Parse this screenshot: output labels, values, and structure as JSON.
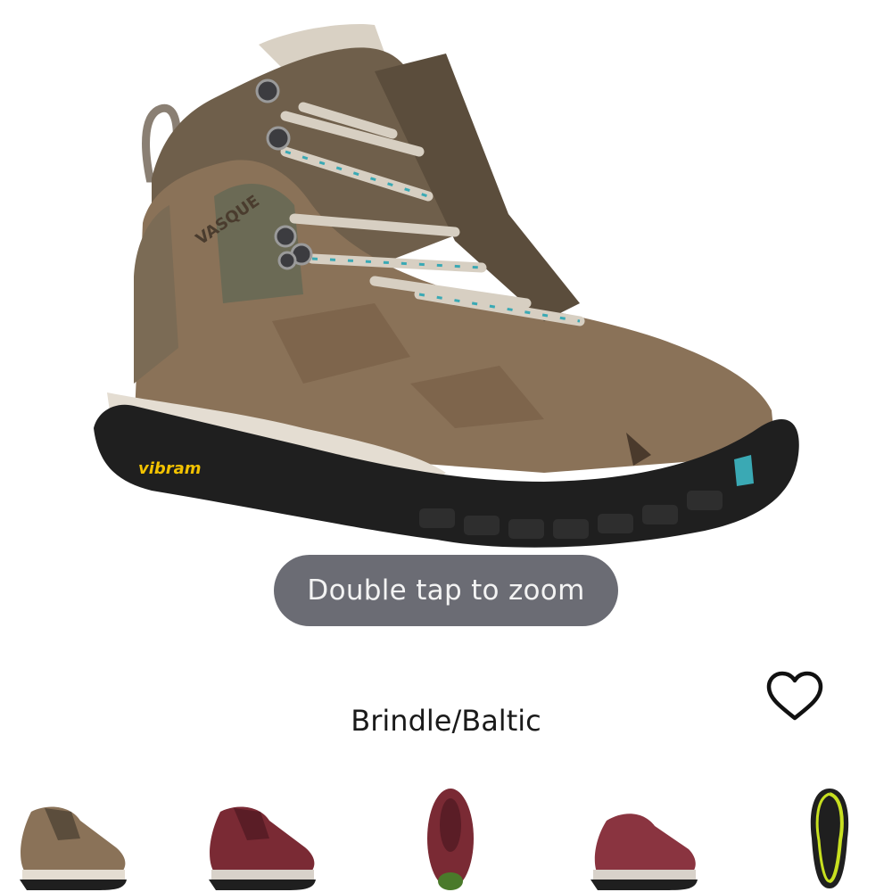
{
  "product": {
    "image_alt": "Vasque women's hiking boot in Brindle/Baltic",
    "brand_mark": "VASQUE",
    "sole_mark": "vibram",
    "zoom_hint": "Double tap to zoom",
    "color_name": "Brindle/Baltic"
  },
  "favorite": {
    "icon": "heart-outline-icon"
  },
  "thumbnails": [
    {
      "name": "thumb-brindle-side",
      "view": "side",
      "color": "Brindle/Baltic"
    },
    {
      "name": "thumb-red-side",
      "view": "side",
      "color": "red"
    },
    {
      "name": "thumb-red-top",
      "view": "top",
      "color": "red"
    },
    {
      "name": "thumb-red-side-2",
      "view": "side",
      "color": "red"
    },
    {
      "name": "thumb-sole",
      "view": "sole",
      "color": "black/lime"
    }
  ],
  "colors": {
    "leather": "#8a7258",
    "sole": "#1f1f1f",
    "midsole": "#e4ddd2",
    "accent": "#3aa9b4",
    "pill": "#6b6c74"
  }
}
